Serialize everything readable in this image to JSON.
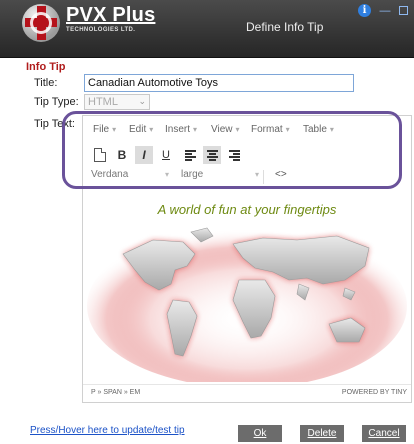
{
  "window": {
    "brand": "PVX Plus",
    "brand_sub": "TECHNOLOGIES LTD.",
    "title": "Define Info Tip"
  },
  "form": {
    "section": "Info Tip",
    "title_label": "Title:",
    "title_value": "Canadian Automotive Toys",
    "tip_type_label": "Tip Type:",
    "tip_type_value": "HTML",
    "tip_text_label": "Tip Text:"
  },
  "editor": {
    "menus": [
      "File",
      "Edit",
      "Insert",
      "View",
      "Format",
      "Table"
    ],
    "font_family": "Verdana",
    "font_size": "large",
    "code_label": "<>",
    "tagline": "A world of fun at your fingertips",
    "path": "P » SPAN » EM",
    "powered": "POWERED BY TINY",
    "colors": {
      "tagline": "#6e8a12",
      "map": "#c9c9c9",
      "glow": "#d12020"
    }
  },
  "footer": {
    "link": "Press/Hover here to update/test tip",
    "ok": "Ok",
    "delete": "Delete",
    "cancel": "Cancel"
  }
}
